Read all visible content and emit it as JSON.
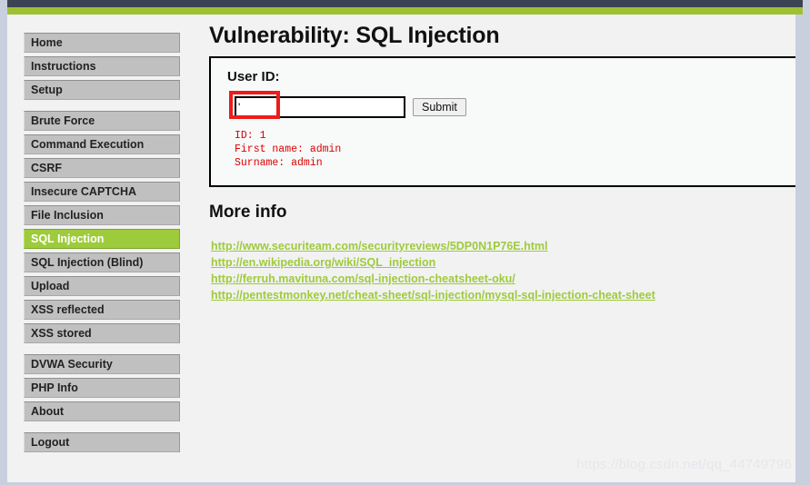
{
  "window": {
    "watermark": "https://blog.csdn.net/qq_44749796"
  },
  "theme": {
    "accent_green": "#9ecb3b",
    "topbar_dark": "#3c4454",
    "nav_gray": "#c0c0c0",
    "result_red": "#dd0000",
    "highlight_red": "#ee1b1b",
    "page_bg": "#f2f2f2",
    "edge_blue": "#c8d0de"
  },
  "sidebar": {
    "groups": [
      {
        "items": [
          {
            "label": "Home",
            "active": false
          },
          {
            "label": "Instructions",
            "active": false
          },
          {
            "label": "Setup",
            "active": false
          }
        ]
      },
      {
        "items": [
          {
            "label": "Brute Force",
            "active": false
          },
          {
            "label": "Command Execution",
            "active": false
          },
          {
            "label": "CSRF",
            "active": false
          },
          {
            "label": "Insecure CAPTCHA",
            "active": false
          },
          {
            "label": "File Inclusion",
            "active": false
          },
          {
            "label": "SQL Injection",
            "active": true
          },
          {
            "label": "SQL Injection (Blind)",
            "active": false
          },
          {
            "label": "Upload",
            "active": false
          },
          {
            "label": "XSS reflected",
            "active": false
          },
          {
            "label": "XSS stored",
            "active": false
          }
        ]
      },
      {
        "items": [
          {
            "label": "DVWA Security",
            "active": false
          },
          {
            "label": "PHP Info",
            "active": false
          },
          {
            "label": "About",
            "active": false
          }
        ]
      },
      {
        "items": [
          {
            "label": "Logout",
            "active": false
          }
        ]
      }
    ]
  },
  "main": {
    "title": "Vulnerability: SQL Injection",
    "form": {
      "label": "User ID:",
      "input_value": "'",
      "input_placeholder": "",
      "submit_label": "Submit"
    },
    "result": "ID: 1\nFirst name: admin\nSurname: admin",
    "more_info": {
      "heading": "More info",
      "links": [
        "http://www.securiteam.com/securityreviews/5DP0N1P76E.html",
        "http://en.wikipedia.org/wiki/SQL_injection",
        "http://ferruh.mavituna.com/sql-injection-cheatsheet-oku/",
        "http://pentestmonkey.net/cheat-sheet/sql-injection/mysql-sql-injection-cheat-sheet"
      ]
    }
  }
}
